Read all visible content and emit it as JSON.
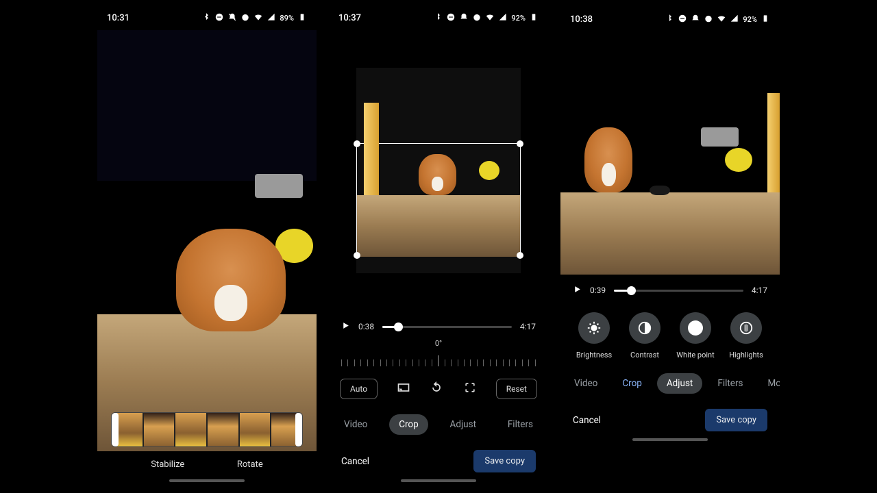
{
  "screens": [
    {
      "statusbar": {
        "time": "10:31",
        "battery": "89%"
      },
      "actions": {
        "stabilize": "Stabilize",
        "rotate": "Rotate"
      }
    },
    {
      "statusbar": {
        "time": "10:37",
        "battery": "92%"
      },
      "playback": {
        "current": "0:38",
        "total": "4:17",
        "progress_pct": 12
      },
      "angle": {
        "label": "0°"
      },
      "buttons": {
        "auto": "Auto",
        "reset": "Reset"
      },
      "tabs": {
        "video": "Video",
        "crop": "Crop",
        "adjust": "Adjust",
        "filters": "Filters"
      },
      "footer": {
        "cancel": "Cancel",
        "save": "Save copy"
      }
    },
    {
      "statusbar": {
        "time": "10:38",
        "battery": "92%"
      },
      "playback": {
        "current": "0:39",
        "total": "4:17",
        "progress_pct": 13
      },
      "adjust": {
        "brightness": "Brightness",
        "contrast": "Contrast",
        "whitepoint": "White point",
        "highlights": "Highlights"
      },
      "tabs": {
        "video": "Video",
        "crop": "Crop",
        "adjust": "Adjust",
        "filters": "Filters",
        "more": "More"
      },
      "footer": {
        "cancel": "Cancel",
        "save": "Save copy"
      }
    }
  ],
  "icons": {
    "bluetooth": "bluetooth-icon",
    "dnd": "dnd-icon",
    "silent": "silent-icon",
    "alarm": "alarm-icon",
    "wifi": "wifi-icon",
    "signal": "signal-icon",
    "battery": "battery-icon"
  },
  "colors": {
    "accent_blue": "#8ab4f8",
    "save_bg": "#1b3a6b",
    "pill_bg": "#3c4043"
  }
}
